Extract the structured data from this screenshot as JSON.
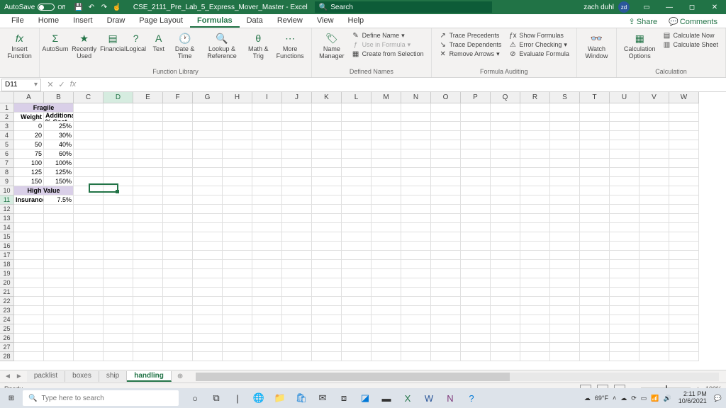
{
  "title": {
    "autosave": "AutoSave",
    "autosave_state": "Off",
    "filename": "CSE_2111_Pre_Lab_5_Express_Mover_Master - Excel",
    "search_ph": "Search",
    "user": "zach duhl",
    "user_initials": "zd"
  },
  "menutabs": [
    "File",
    "Home",
    "Insert",
    "Draw",
    "Page Layout",
    "Formulas",
    "Data",
    "Review",
    "View",
    "Help"
  ],
  "menutabs_active": 5,
  "share": "Share",
  "comments": "Comments",
  "ribbon": {
    "g1": {
      "insert_fn": "Insert\nFunction"
    },
    "g2": {
      "autosum": "AutoSum",
      "recent": "Recently\nUsed",
      "financial": "Financial",
      "logical": "Logical",
      "text": "Text",
      "datetime": "Date &\nTime",
      "lookup": "Lookup &\nReference",
      "math": "Math &\nTrig",
      "more": "More\nFunctions",
      "label": "Function Library"
    },
    "g3": {
      "name_mgr": "Name\nManager",
      "def_name": "Define Name",
      "use_formula": "Use in Formula",
      "create_sel": "Create from Selection",
      "label": "Defined Names"
    },
    "g4": {
      "trace_prec": "Trace Precedents",
      "trace_dep": "Trace Dependents",
      "remove_arr": "Remove Arrows",
      "show_form": "Show Formulas",
      "err_check": "Error Checking",
      "eval_form": "Evaluate Formula",
      "label": "Formula Auditing"
    },
    "g5": {
      "watch": "Watch\nWindow"
    },
    "g6": {
      "calc_opt": "Calculation\nOptions",
      "calc_now": "Calculate Now",
      "calc_sheet": "Calculate Sheet",
      "label": "Calculation"
    }
  },
  "namebox": "D11",
  "cols": [
    "A",
    "B",
    "C",
    "D",
    "E",
    "F",
    "G",
    "H",
    "I",
    "J",
    "K",
    "L",
    "M",
    "N",
    "O",
    "P",
    "Q",
    "R",
    "S",
    "T",
    "U",
    "V",
    "W"
  ],
  "rows": 28,
  "selected_col": 3,
  "selected_row": 11,
  "data": {
    "1": {
      "A": "Fragile",
      "merge": "AB",
      "cls": "hdr"
    },
    "h2": {
      "A": "Weight",
      "B": "Additional % Cost"
    },
    "t": [
      {
        "A": "0",
        "B": "25%"
      },
      {
        "A": "20",
        "B": "30%"
      },
      {
        "A": "50",
        "B": "40%"
      },
      {
        "A": "75",
        "B": "60%"
      },
      {
        "A": "100",
        "B": "100%"
      },
      {
        "A": "125",
        "B": "125%"
      },
      {
        "A": "150",
        "B": "150%"
      }
    ],
    "10": {
      "A": "High Value",
      "merge": "AB",
      "cls": "hdr2"
    },
    "11": {
      "A": "Insurance",
      "B": "7.5%"
    }
  },
  "sheets": [
    "packlist",
    "boxes",
    "ship",
    "handling"
  ],
  "active_sheet": 3,
  "status": "Ready",
  "zoom": "100%",
  "taskbar": {
    "search_ph": "Type here to search",
    "temp": "69°F",
    "time": "2:11 PM",
    "date": "10/6/2021"
  }
}
